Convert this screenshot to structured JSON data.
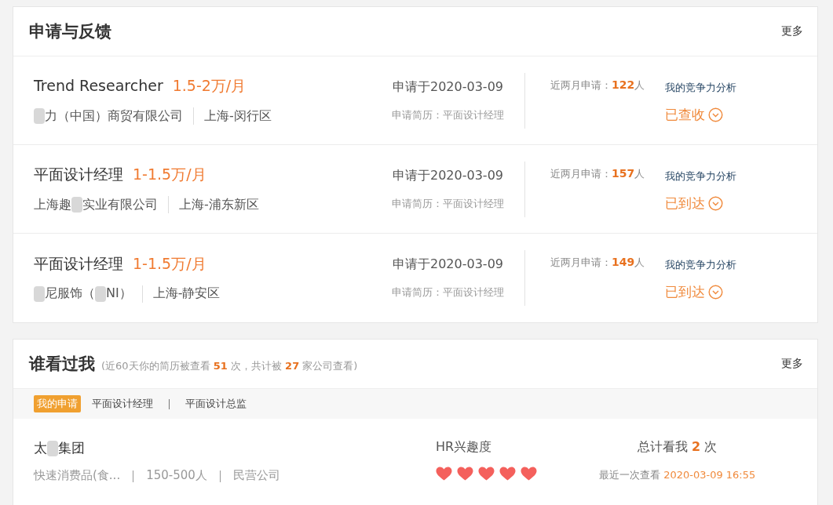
{
  "applications": {
    "title": "申请与反馈",
    "more": "更多",
    "items": [
      {
        "job": "Trend Researcher",
        "salary": "1.5-2万/月",
        "company": [
          {
            "kind": "redacted"
          },
          {
            "kind": "text",
            "text": "力（中国）商贸有限公司"
          }
        ],
        "location": "上海-闵行区",
        "date": "申请于2020-03-09",
        "resume_label": "申请简历：",
        "resume": "平面设计经理",
        "recent_label": "近两月申请：",
        "recent_count": "122",
        "recent_unit": "人",
        "analysis": "我的竞争力分析",
        "status": "已查收"
      },
      {
        "job": "平面设计经理",
        "salary": "1-1.5万/月",
        "company": [
          {
            "kind": "text",
            "text": "上海趣"
          },
          {
            "kind": "redacted"
          },
          {
            "kind": "text",
            "text": "实业有限公司"
          }
        ],
        "location": "上海-浦东新区",
        "date": "申请于2020-03-09",
        "resume_label": "申请简历：",
        "resume": "平面设计经理",
        "recent_label": "近两月申请：",
        "recent_count": "157",
        "recent_unit": "人",
        "analysis": "我的竞争力分析",
        "status": "已到达"
      },
      {
        "job": "平面设计经理",
        "salary": "1-1.5万/月",
        "company": [
          {
            "kind": "redacted"
          },
          {
            "kind": "text",
            "text": "尼服饰（"
          },
          {
            "kind": "redacted"
          },
          {
            "kind": "text",
            "text": "NI）"
          }
        ],
        "location": "上海-静安区",
        "date": "申请于2020-03-09",
        "resume_label": "申请简历：",
        "resume": "平面设计经理",
        "recent_label": "近两月申请：",
        "recent_count": "149",
        "recent_unit": "人",
        "analysis": "我的竞争力分析",
        "status": "已到达"
      }
    ]
  },
  "viewers": {
    "title": "谁看过我",
    "summary": "(近60天你的简历被查看 **51** 次，共计被 **27** 家公司查看)",
    "more": "更多",
    "tabs": [
      {
        "label": "我的申请",
        "selected": true
      },
      {
        "label": "平面设计经理",
        "selected": false
      },
      {
        "label": "平面设计总监",
        "selected": false
      }
    ],
    "items": [
      {
        "company": [
          {
            "kind": "text",
            "text": "太"
          },
          {
            "kind": "redacted"
          },
          {
            "kind": "text",
            "text": "集团"
          }
        ],
        "industry": "快速消费品(食...",
        "size": "150-500人",
        "type": "民营公司",
        "interest_label": "HR兴趣度",
        "stars": 5,
        "total_label": "总计看我 **2** 次",
        "last_label": "最近一次查看",
        "last_time": "2020-03-09 16:55"
      }
    ]
  }
}
